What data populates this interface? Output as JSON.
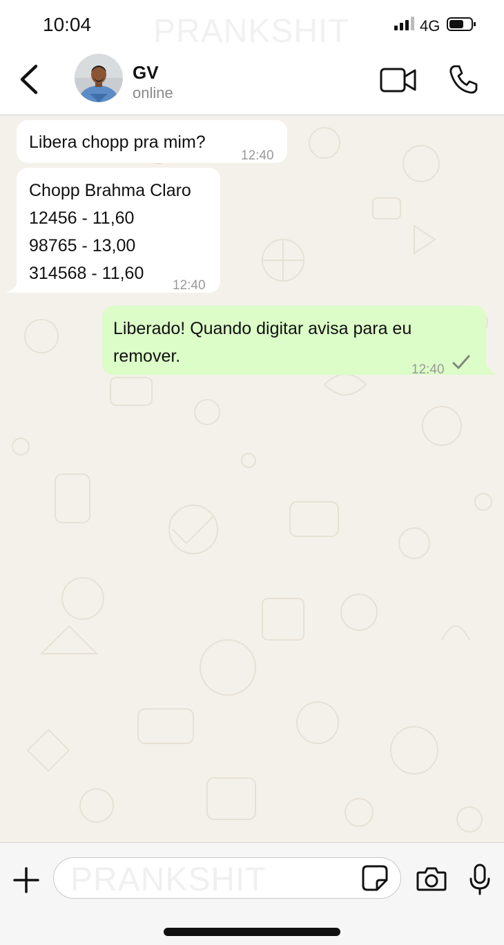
{
  "status_bar": {
    "time": "10:04",
    "watermark": "PRANKSHIT",
    "network": "4G"
  },
  "header": {
    "contact_name": "GV",
    "contact_status": "online",
    "icons": [
      "chevron-left-icon",
      "video-camera-icon",
      "phone-icon"
    ]
  },
  "messages": [
    {
      "direction": "incoming",
      "text": "Libera chopp pra mim?",
      "time": "12:40"
    },
    {
      "direction": "incoming",
      "text": "Chopp Brahma Claro\n12456 - 11,60\n98765 - 13,00\n314568 - 11,60",
      "time": "12:40"
    },
    {
      "direction": "outgoing",
      "text": "Liberado! Quando digitar avisa para eu\nremover.",
      "time": "12:40",
      "status": "sent"
    }
  ],
  "input_bar": {
    "watermark": "PRANKSHIT",
    "icons": [
      "plus-icon",
      "sticker-icon",
      "camera-icon",
      "microphone-icon"
    ]
  },
  "colors": {
    "chat_background": "#f4f1ea",
    "incoming_bubble": "#ffffff",
    "outgoing_bubble": "#dcfcc8"
  }
}
